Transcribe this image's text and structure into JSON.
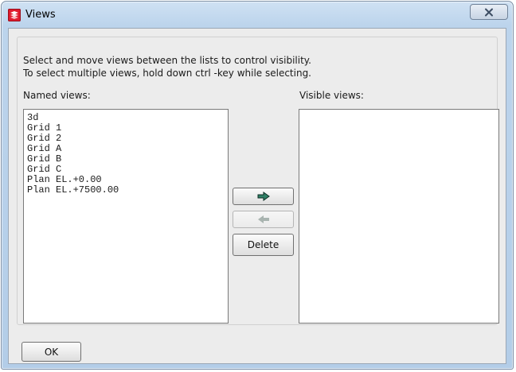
{
  "window": {
    "title": "Views",
    "close_icon": "close-icon"
  },
  "instructions": {
    "line1": "Select and move views between the lists to control visibility.",
    "line2": "To select multiple views, hold down ctrl -key while selecting."
  },
  "named_views": {
    "label": "Named views:",
    "items": [
      "3d",
      "Grid 1",
      "Grid 2",
      "Grid A",
      "Grid B",
      "Grid C",
      "Plan EL.+0.00",
      "Plan EL.+7500.00"
    ]
  },
  "visible_views": {
    "label": "Visible views:",
    "items": []
  },
  "buttons": {
    "move_right_icon": "arrow-right-icon",
    "move_left_icon": "arrow-left-icon",
    "move_left_enabled": false,
    "delete_label": "Delete",
    "ok_label": "OK"
  },
  "colors": {
    "arrow_enabled": "#2f7f66",
    "arrow_disabled": "#a9b4b0",
    "app_icon": "#e01a2d"
  }
}
